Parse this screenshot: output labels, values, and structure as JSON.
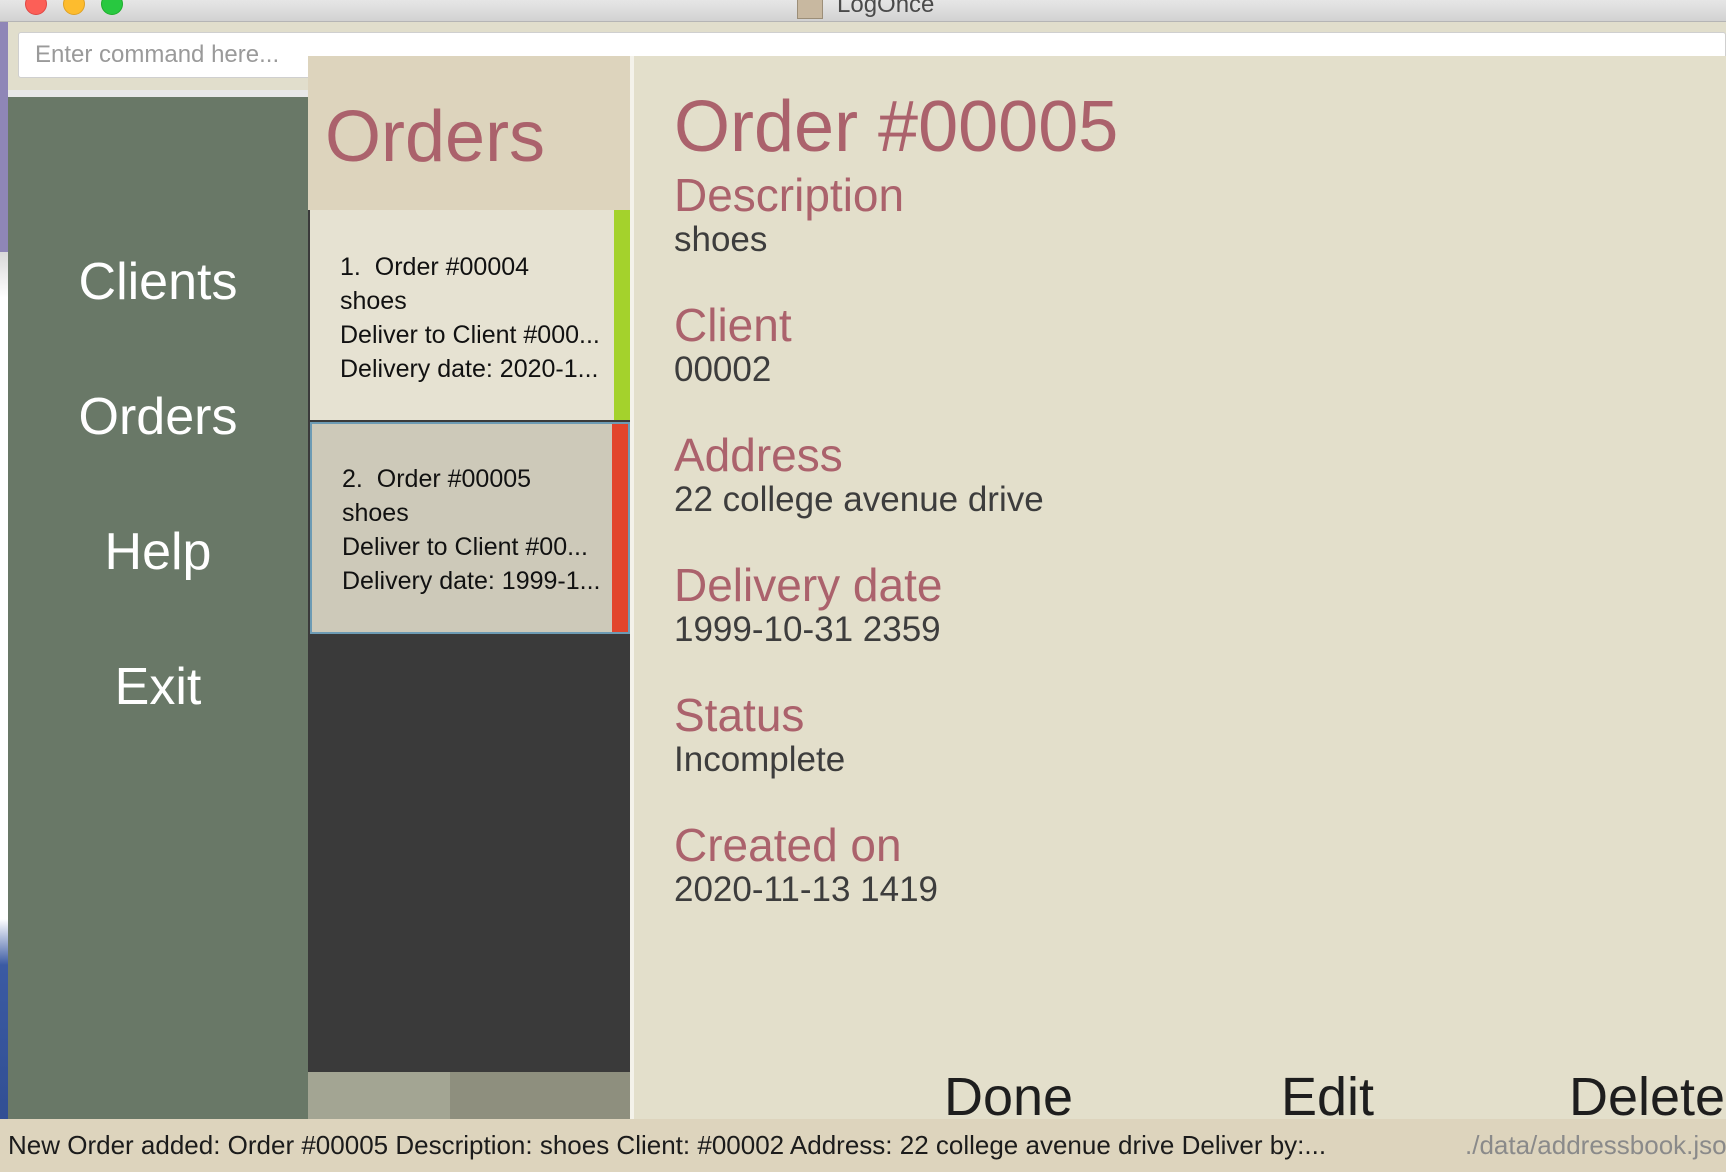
{
  "window": {
    "title": "LogOnce",
    "icon": "app-icon",
    "controls": [
      "close",
      "minimize",
      "maximize"
    ]
  },
  "command": {
    "placeholder": "Enter command here...",
    "value": ""
  },
  "sidebar": {
    "items": [
      {
        "label": "Clients"
      },
      {
        "label": "Orders"
      },
      {
        "label": "Help"
      },
      {
        "label": "Exit"
      }
    ]
  },
  "orders_list": {
    "title": "Orders",
    "items": [
      {
        "index": "1.",
        "order": "Order #00004",
        "description": "shoes",
        "deliver_to": "Deliver to Client #000...",
        "delivery_date": "Delivery date: 2020-1...",
        "status_color": "#a4d22c",
        "selected": false
      },
      {
        "index": "2.",
        "order": "Order #00005",
        "description": "shoes",
        "deliver_to": "Deliver to Client #00...",
        "delivery_date": "Delivery date: 1999-1...",
        "status_color": "#e2452c",
        "selected": true
      }
    ]
  },
  "detail": {
    "title": "Order #00005",
    "fields": [
      {
        "label": "Description",
        "value": "shoes"
      },
      {
        "label": "Client",
        "value": "00002"
      },
      {
        "label": "Address",
        "value": "22 college avenue drive"
      },
      {
        "label": "Delivery date",
        "value": "1999-10-31 2359"
      },
      {
        "label": "Status",
        "value": "Incomplete"
      },
      {
        "label": "Created on",
        "value": "2020-11-13 1419"
      }
    ],
    "actions": {
      "done": "Done",
      "edit": "Edit",
      "delete": "Delete"
    }
  },
  "statusbar": {
    "message": "New Order added: Order #00005  Description: shoes Client: #00002 Address: 22 college avenue drive Deliver by:...",
    "path": "./data/addressbook.json"
  },
  "colors": {
    "accent": "#ab626c",
    "sidebar": "#697867",
    "panel": "#e3dfcb",
    "header": "#ddd4bd"
  }
}
